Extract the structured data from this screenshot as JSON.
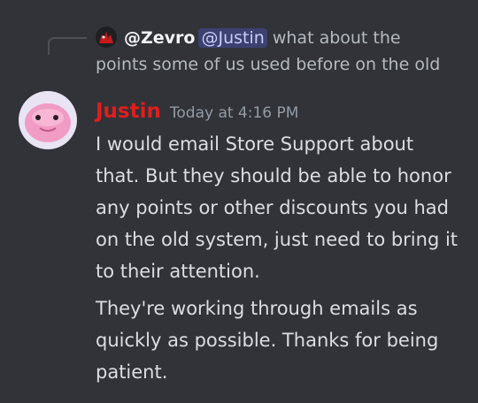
{
  "reply": {
    "author": "@Zevro",
    "mention": "@Justin",
    "text": " what about the points some of us used before on the old"
  },
  "message": {
    "author": "Justin",
    "timestamp": "Today at 4:16 PM",
    "author_color": "#e01e1e",
    "paragraphs": [
      "I would email Store Support about that. But they should be able to honor any points or other discounts you had on the old system, just need to bring it to their attention.",
      "They're working through emails as quickly as possible. Thanks for being patient."
    ]
  },
  "colors": {
    "background": "#313338",
    "mention_bg": "#5865f24d",
    "mention_text": "#c9cdfb",
    "muted_text": "#b5bac1",
    "body_text": "#dbdee1"
  }
}
